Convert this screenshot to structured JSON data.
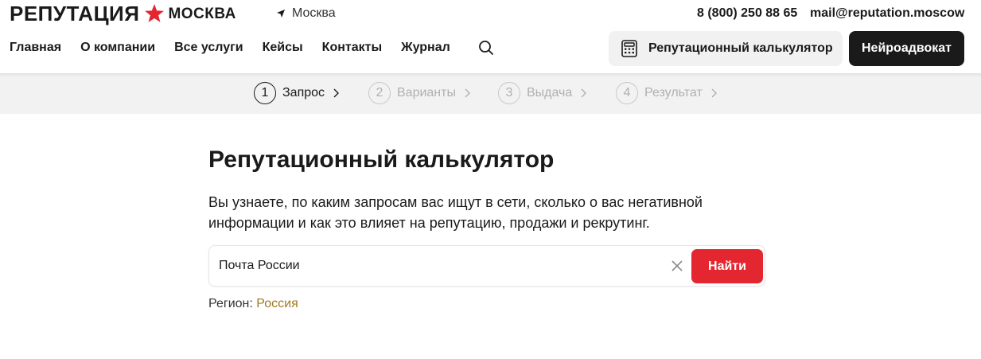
{
  "header": {
    "logo_main": "РЕПУТАЦИЯ",
    "logo_city": "МОСКВА",
    "city": "Москва",
    "phone": "8 (800) 250 88 65",
    "email": "mail@reputation.moscow",
    "nav": [
      "Главная",
      "О компании",
      "Все услуги",
      "Кейсы",
      "Контакты",
      "Журнал"
    ],
    "calc_button": "Репутационный калькулятор",
    "neuro_button": "Нейроадвокат"
  },
  "steps": [
    {
      "num": "1",
      "label": "Запрос",
      "active": true
    },
    {
      "num": "2",
      "label": "Варианты",
      "active": false
    },
    {
      "num": "3",
      "label": "Выдача",
      "active": false
    },
    {
      "num": "4",
      "label": "Результат",
      "active": false
    }
  ],
  "main": {
    "title": "Репутационный калькулятор",
    "description_line1": "Вы узнаете, по каким запросам вас ищут в сети, сколько о вас негативной",
    "description_line2": "информации и как это влияет на репутацию, продажи и рекрутинг.",
    "search_value": "Почта России",
    "find_button": "Найти",
    "region_label": "Регион:",
    "region_value": "Россия"
  },
  "colors": {
    "accent_red": "#e3262f",
    "dark": "#1a1a1a",
    "region_link": "#a07a1e",
    "steps_bg": "#f2f2f2"
  },
  "icons": [
    "star-icon",
    "location-arrow-icon",
    "search-icon",
    "calculator-icon",
    "chevron-right-icon",
    "close-icon"
  ]
}
